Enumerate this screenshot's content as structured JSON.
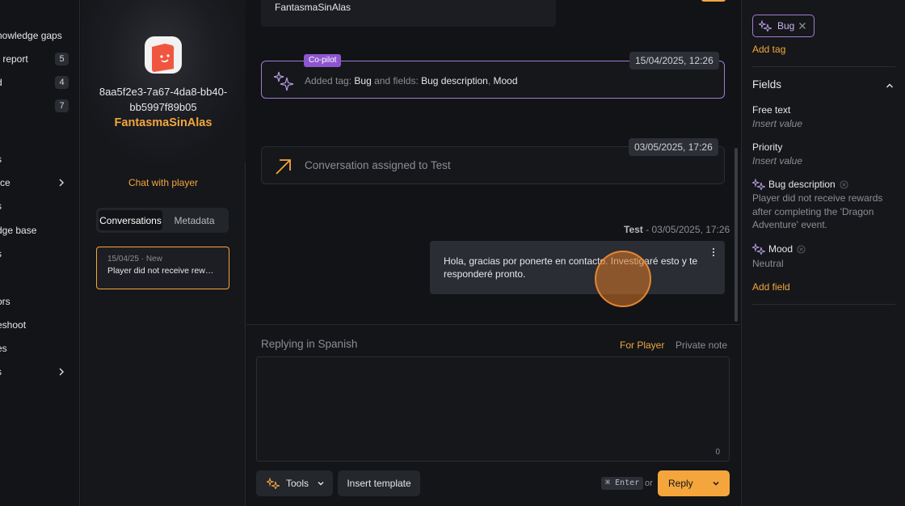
{
  "nav": {
    "items": [
      {
        "label": "nowledge gaps",
        "badge": ""
      },
      {
        "label": "r report",
        "badge": "5"
      },
      {
        "label": "d",
        "badge": "4"
      },
      {
        "label": "",
        "badge": "7"
      },
      {
        "label": "s",
        "badge": ""
      },
      {
        "label": "rce",
        "badge": ""
      },
      {
        "label": "s",
        "badge": ""
      },
      {
        "label": "dge base",
        "badge": ""
      },
      {
        "label": "s",
        "badge": ""
      },
      {
        "label": "ors",
        "badge": ""
      },
      {
        "label": "eshoot",
        "badge": ""
      },
      {
        "label": "es",
        "badge": ""
      },
      {
        "label": "s",
        "badge": ""
      }
    ]
  },
  "player": {
    "id_line1": "8aa5f2e3-7a67-4da8-bb40-",
    "id_line2": "bb5997f89b05",
    "name": "FantasmaSinAlas",
    "chat_link": "Chat with player",
    "tabs": [
      "Conversations",
      "Metadata"
    ],
    "conversation": {
      "meta": "15/04/25 · New",
      "title": "Player did not receive rewards after completing the 'Dragon Adventure' event."
    }
  },
  "thread": {
    "top_message": "FantasmaSinAlas",
    "copilot_event": {
      "badge": "Co-pilot",
      "timestamp": "15/04/2025, 12:26",
      "prefix": "Added tag: ",
      "tag": "Bug",
      "mid": " and fields: ",
      "field1": "Bug description",
      "sep": ", ",
      "field2": "Mood"
    },
    "assign_event": {
      "timestamp": "03/05/2025, 17:26",
      "text": "Conversation assigned to Test"
    },
    "agent_reply": {
      "author": "Test",
      "sep": " - ",
      "timestamp": "03/05/2025, 17:26",
      "text": "Hola, gracias por ponerte en contacto. Investigaré esto y te responderé pronto."
    }
  },
  "composer": {
    "replying_label": "Replying in Spanish",
    "for_player": "For Player",
    "private_note": "Private note",
    "counter": "0",
    "tools": "Tools",
    "insert_template": "Insert template",
    "shortcut": "⌘ Enter",
    "or": "or",
    "reply": "Reply"
  },
  "details": {
    "tag": "Bug",
    "add_tag": "Add tag",
    "fields_title": "Fields",
    "fields": [
      {
        "label": "Free text",
        "value": "Insert value",
        "placeholder": true,
        "ai": false
      },
      {
        "label": "Priority",
        "value": "Insert value",
        "placeholder": true,
        "ai": false
      },
      {
        "label": "Bug description",
        "value": "Player did not receive rewards after completing the 'Dragon Adventure' event.",
        "placeholder": false,
        "ai": true
      },
      {
        "label": "Mood",
        "value": "Neutral",
        "placeholder": false,
        "ai": true
      }
    ],
    "add_field": "Add field"
  },
  "colors": {
    "accent": "#f4a63c",
    "copilot": "#8f55d0",
    "background": "#111317"
  }
}
